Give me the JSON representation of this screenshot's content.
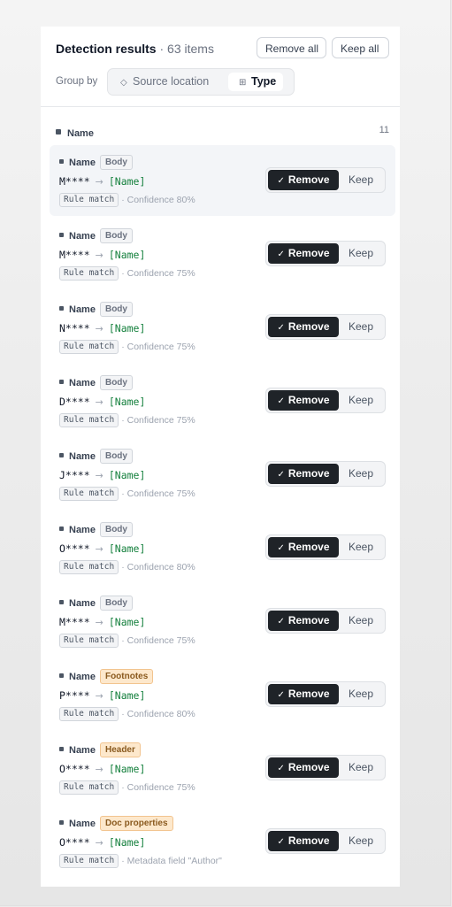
{
  "header": {
    "title": "Detection results",
    "count": " · 63 items",
    "remove_all": "Remove all",
    "keep_all": "Keep all",
    "group_by_label": "Group by",
    "group_options": [
      "Source location",
      "Type"
    ],
    "selected_group": "Type"
  },
  "section": {
    "name": "Name",
    "count": "11"
  },
  "labels": {
    "remove": "Remove",
    "keep": "Keep"
  },
  "items": [
    {
      "category": "Name",
      "tag": "Body",
      "masked": "M****",
      "token": "[Name]",
      "match": "Rule match",
      "detail": "· Confidence 80%",
      "decision": "Remove"
    },
    {
      "category": "Name",
      "tag": "Body",
      "masked": "M****",
      "token": "[Name]",
      "match": "Rule match",
      "detail": "· Confidence 75%",
      "decision": "Remove"
    },
    {
      "category": "Name",
      "tag": "Body",
      "masked": "N****",
      "token": "[Name]",
      "match": "Rule match",
      "detail": "· Confidence 75%",
      "decision": "Remove"
    },
    {
      "category": "Name",
      "tag": "Body",
      "masked": "D****",
      "token": "[Name]",
      "match": "Rule match",
      "detail": "· Confidence 75%",
      "decision": "Remove"
    },
    {
      "category": "Name",
      "tag": "Body",
      "masked": "J****",
      "token": "[Name]",
      "match": "Rule match",
      "detail": "· Confidence 75%",
      "decision": "Remove"
    },
    {
      "category": "Name",
      "tag": "Body",
      "masked": "O****",
      "token": "[Name]",
      "match": "Rule match",
      "detail": "· Confidence 80%",
      "decision": "Remove"
    },
    {
      "category": "Name",
      "tag": "Body",
      "masked": "M****",
      "token": "[Name]",
      "match": "Rule match",
      "detail": "· Confidence 75%",
      "decision": "Remove"
    },
    {
      "category": "Name",
      "tag": "Footnotes",
      "masked": "P****",
      "token": "[Name]",
      "match": "Rule match",
      "detail": "· Confidence 80%",
      "decision": "Remove"
    },
    {
      "category": "Name",
      "tag": "Header",
      "masked": "O****",
      "token": "[Name]",
      "match": "Rule match",
      "detail": "· Confidence 75%",
      "decision": "Remove"
    },
    {
      "category": "Name",
      "tag": "Doc properties",
      "masked": "O****",
      "token": "[Name]",
      "match": "Rule match",
      "detail": "· Metadata field \"Author\"",
      "decision": "Remove"
    }
  ],
  "colors": {
    "accent_dark": "#1f2328",
    "token_green": "#15803d",
    "warm_tag_bg": "#fde8cc"
  }
}
